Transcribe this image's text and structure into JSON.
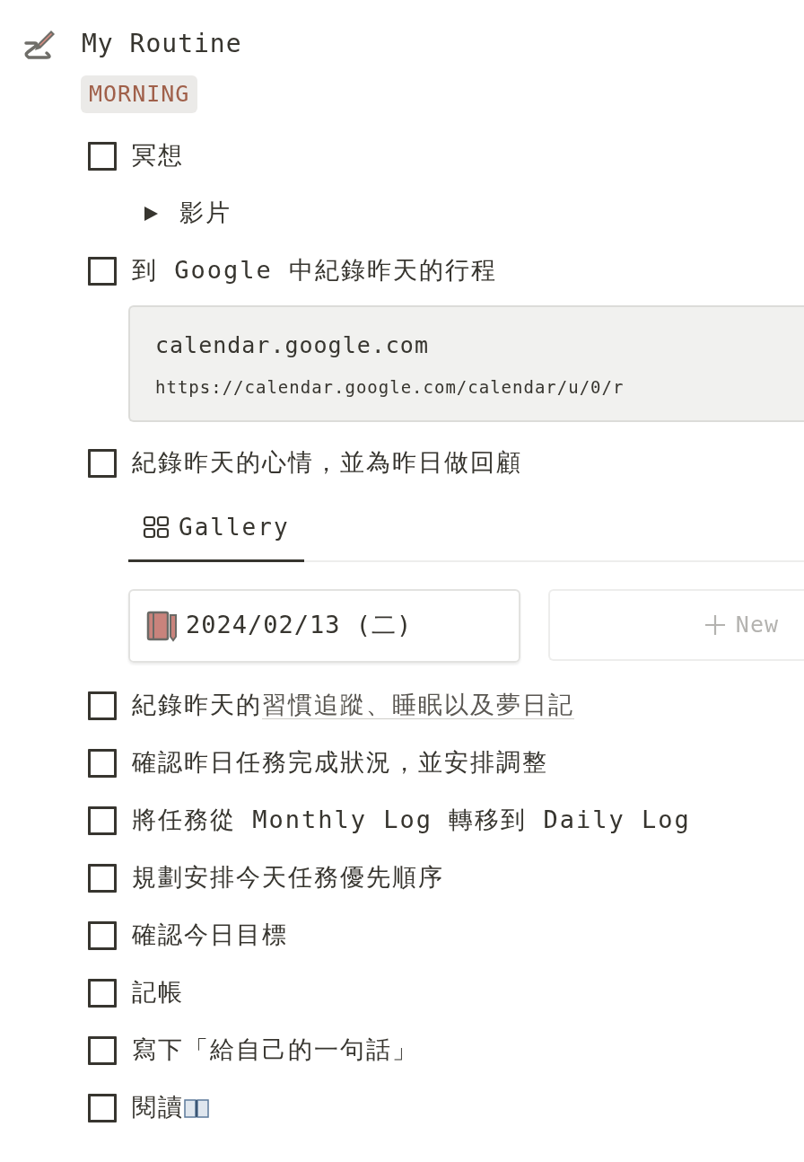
{
  "page": {
    "title": "My Routine"
  },
  "section_label": "MORNING",
  "blocks": [
    {
      "kind": "todo",
      "text": "冥想",
      "checked": false,
      "children": [
        {
          "kind": "toggle",
          "text": "影片",
          "expanded": false
        }
      ]
    },
    {
      "kind": "todo",
      "text": "到 Google 中紀錄昨天的行程",
      "checked": false,
      "children": [
        {
          "kind": "bookmark",
          "title": "calendar.google.com",
          "url": "https://calendar.google.com/calendar/u/0/r"
        }
      ]
    },
    {
      "kind": "todo",
      "text": "紀錄昨天的心情，並為昨日做回顧",
      "checked": false,
      "children": [
        {
          "kind": "gallery",
          "view": {
            "label": "Gallery",
            "selected": true
          },
          "cards": [
            {
              "title": "2024/02/13 (二)"
            }
          ],
          "new_label": "New"
        }
      ]
    },
    {
      "kind": "todo",
      "text": "紀錄昨天的",
      "link": "習慣追蹤、睡眠以及夢日記",
      "checked": false
    },
    {
      "kind": "todo",
      "text": "確認昨日任務完成狀況，並安排調整",
      "checked": false
    },
    {
      "kind": "todo",
      "text": "將任務從 Monthly Log 轉移到 Daily Log",
      "checked": false
    },
    {
      "kind": "todo",
      "text": "規劃安排今天任務優先順序",
      "checked": false
    },
    {
      "kind": "todo",
      "text": "確認今日目標",
      "checked": false
    },
    {
      "kind": "todo",
      "text": "記帳",
      "checked": false
    },
    {
      "kind": "todo",
      "text": "寫下「給自己的一句話」",
      "checked": false
    },
    {
      "kind": "todo",
      "text": "閱讀",
      "book_icon": true,
      "checked": false
    }
  ]
}
